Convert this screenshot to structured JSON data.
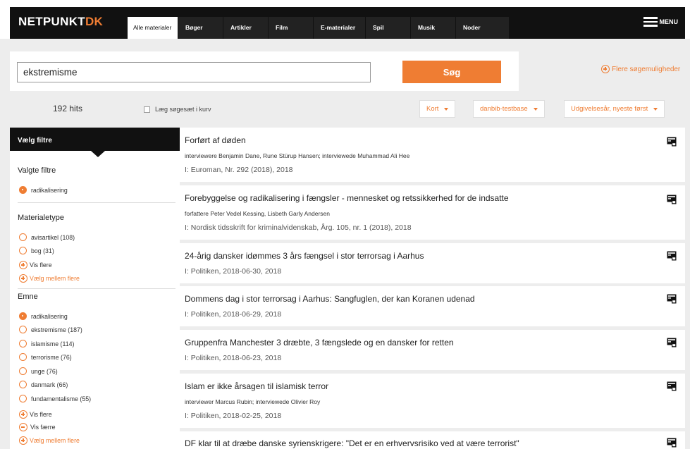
{
  "brand": {
    "name_part1": "NETPUNKT",
    "name_part2": "DK"
  },
  "nav": {
    "tabs": [
      {
        "label": "Alle materialer",
        "active": true
      },
      {
        "label": "Bøger"
      },
      {
        "label": "Artikler"
      },
      {
        "label": "Film"
      },
      {
        "label": "E-materialer"
      },
      {
        "label": "Spil"
      },
      {
        "label": "Musik"
      },
      {
        "label": "Noder"
      }
    ],
    "menu_label": "MENU"
  },
  "search": {
    "value": "ekstremisme",
    "button_label": "Søg",
    "more_options_label": "Flere søgemuligheder"
  },
  "hitsbar": {
    "hits": "192 hits",
    "basket_label": "Læg søgesæt i kurv",
    "dropdowns": [
      "Kort",
      "danbib-testbase",
      "Udgivelsesår, nyeste først"
    ]
  },
  "sidebar": {
    "header": "Vælg filtre",
    "selected_title": "Valgte filtre",
    "selected": [
      "radikalisering"
    ],
    "materialtype_title": "Materialetype",
    "materialtype": [
      "avisartikel (108)",
      "bog (31)"
    ],
    "show_more": "Vis flere",
    "choose_between": "Vælg mellem flere",
    "emne_title": "Emne",
    "emne": [
      "radikalisering",
      "ekstremisme (187)",
      "islamisme (114)",
      "terrorisme (76)",
      "unge (76)",
      "danmark (66)",
      "fundamentalisme (55)"
    ],
    "show_less": "Vis færre"
  },
  "results": [
    {
      "title": "Forført af døden",
      "authors": "interviewere Benjamin Dane, Rune Stürup Hansen; interviewede Muhammad Ali Hee",
      "source": "I: Euroman, Nr. 292 (2018), 2018"
    },
    {
      "title": "Forebyggelse og radikalisering i fængsler - mennesket og retssikkerhed for de indsatte",
      "authors": "forfattere Peter Vedel Kessing, Lisbeth Garly Andersen",
      "source": "I: Nordisk tidsskrift for kriminalvidenskab, Årg. 105, nr. 1 (2018), 2018"
    },
    {
      "title": "24-årig dansker idømmes 3 års fængsel i stor terrorsag i Aarhus",
      "source": "I: Politiken, 2018-06-30, 2018"
    },
    {
      "title": "Dommens dag i stor terrorsag i Aarhus: Sangfuglen, der kan Koranen udenad",
      "source": "I: Politiken, 2018-06-29, 2018"
    },
    {
      "title": "Gruppenfra Manchester 3 dræbte, 3 fængslede og en dansker for retten",
      "source": "I: Politiken, 2018-06-23, 2018"
    },
    {
      "title": "Islam er ikke årsagen til islamisk terror",
      "authors": "interviewer Marcus Rubin; interviewede Olivier Roy",
      "source": "I: Politiken, 2018-02-25, 2018"
    },
    {
      "title": "DF klar til at dræbe danske syrienskrigere: \"Det er en erhvervsrisiko ved at være terrorist\""
    }
  ],
  "colors": {
    "accent": "#ef7d33",
    "topbar": "#111111",
    "background": "#ededed"
  },
  "icons": {
    "result_icon": "newspaper-icon",
    "menu_icon": "hamburger-icon",
    "more_options_icon": "plus-circle-icon"
  }
}
